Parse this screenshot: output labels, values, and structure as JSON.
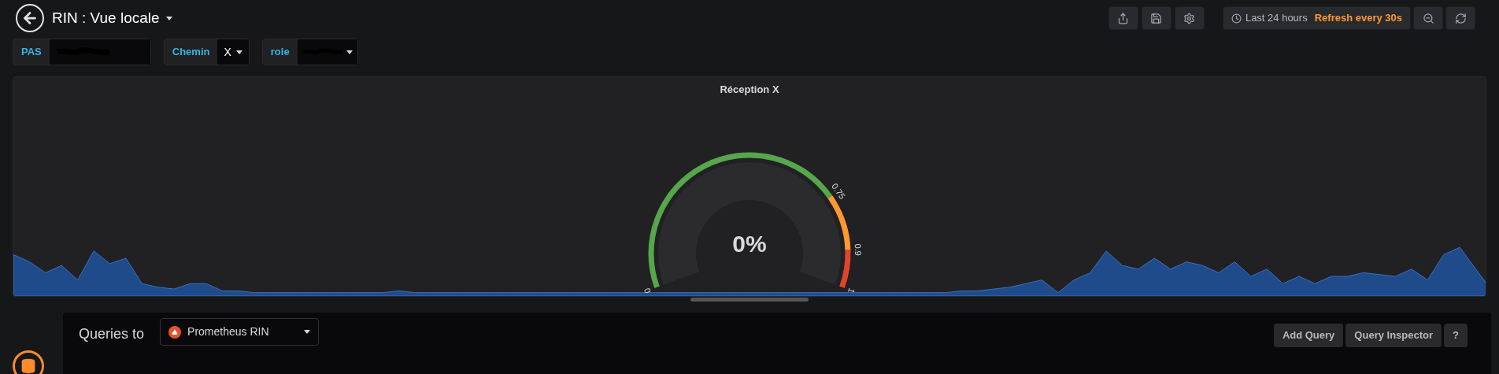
{
  "header": {
    "title": "RIN : Vue locale"
  },
  "toolbar": {
    "time_range": "Last 24 hours",
    "refresh": "Refresh every 30s"
  },
  "variables": [
    {
      "label": "PAS",
      "kind": "redacted"
    },
    {
      "label": "Chemin",
      "value": "X",
      "kind": "dropdown"
    },
    {
      "label": "role",
      "kind": "redacted_dropdown"
    }
  ],
  "panel": {
    "title": "Réception X",
    "gauge": {
      "reading": "0%",
      "scale_labels": [
        "0",
        "0.75",
        "0.9",
        "1"
      ],
      "bands": [
        {
          "color": "#56a64b"
        },
        {
          "color": "#ff9830"
        },
        {
          "color": "#e0452c"
        }
      ]
    }
  },
  "queries": {
    "label": "Queries to",
    "datasource": "Prometheus RIN",
    "buttons": [
      "Add Query",
      "Query Inspector",
      "?"
    ]
  }
}
